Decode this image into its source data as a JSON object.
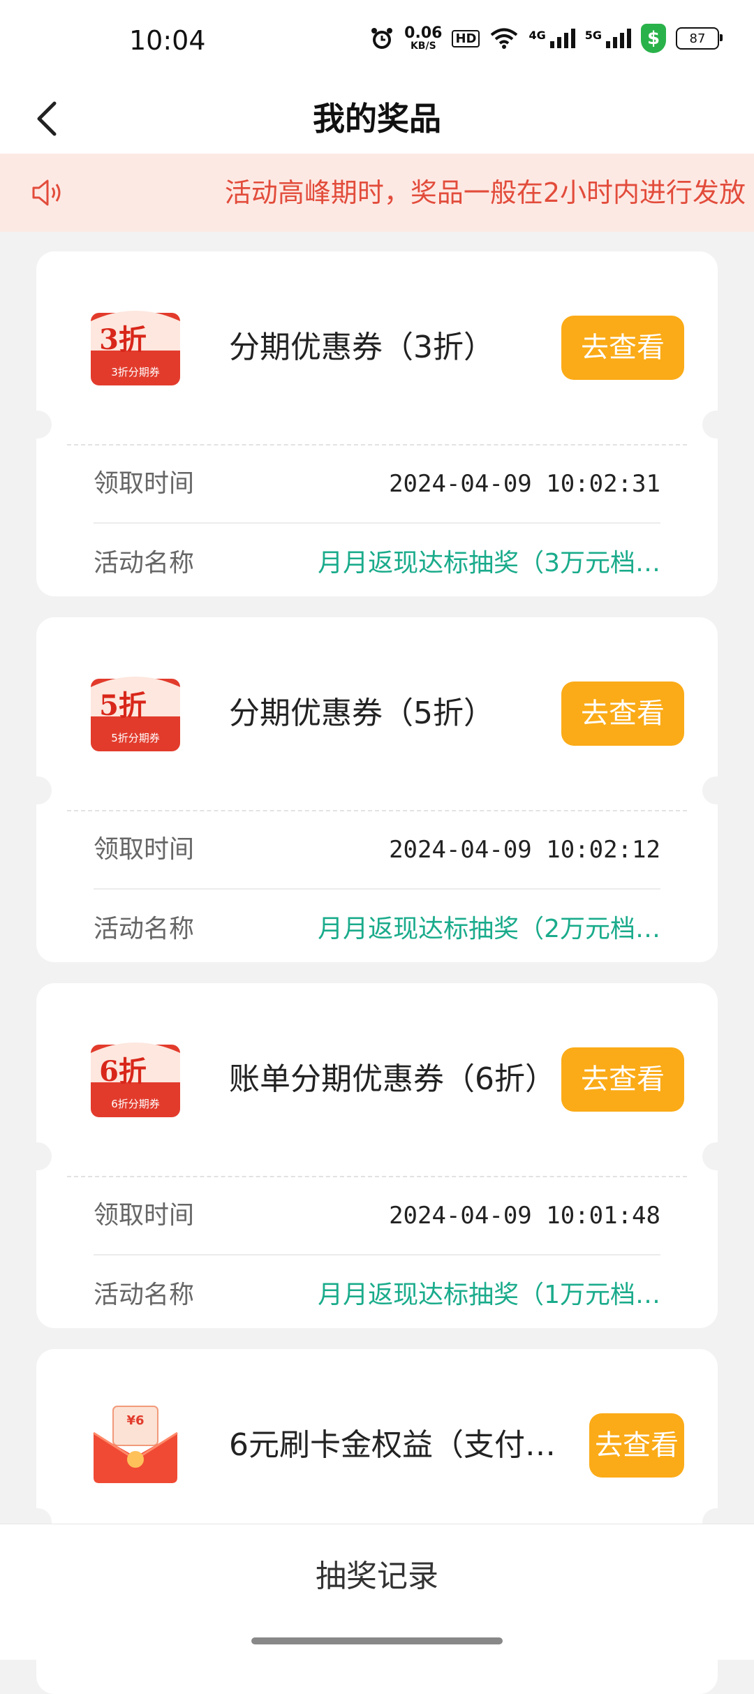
{
  "status": {
    "time": "10:04",
    "net_speed": "0.06",
    "net_unit": "KB/S",
    "hd": "HD",
    "net1": "4G",
    "net2": "5G",
    "battery": "87"
  },
  "nav": {
    "title": "我的奖品"
  },
  "notice": {
    "text": "活动高峰期时，奖品一般在2小时内进行发放"
  },
  "prizes": [
    {
      "badge_big": "3折",
      "badge_small": "3折分期券",
      "title": "分期优惠券（3折）",
      "button": "去查看",
      "time_label": "领取时间",
      "time": "2024-04-09  10:02:31",
      "activity_label": "活动名称",
      "activity": "月月返现达标抽奖（3万元档…"
    },
    {
      "badge_big": "5折",
      "badge_small": "5折分期券",
      "title": "分期优惠券（5折）",
      "button": "去查看",
      "time_label": "领取时间",
      "time": "2024-04-09  10:02:12",
      "activity_label": "活动名称",
      "activity": "月月返现达标抽奖（2万元档…"
    },
    {
      "badge_big": "6折",
      "badge_small": "6折分期券",
      "title": "账单分期优惠券（6折）",
      "button": "去查看",
      "time_label": "领取时间",
      "time": "2024-04-09  10:01:48",
      "activity_label": "活动名称",
      "activity": "月月返现达标抽奖（1万元档…"
    },
    {
      "badge_big": "¥6",
      "title": "6元刷卡金权益（支付…",
      "button": "去查看"
    }
  ],
  "bottom": {
    "label": "抽奖记录"
  },
  "colors": {
    "accent": "#fbab17",
    "activity": "#1aab8b",
    "notice": "#e24c3b"
  }
}
